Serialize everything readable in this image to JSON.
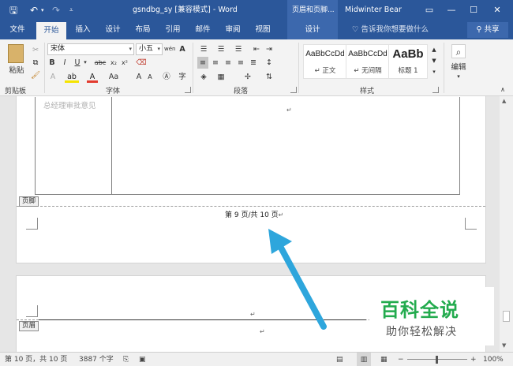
{
  "titlebar": {
    "doc_title": "gsndbg_sy [兼容模式] - Word",
    "context_tab": "页眉和页脚...",
    "user": "Midwinter Bear"
  },
  "tabs": [
    "文件",
    "开始",
    "插入",
    "设计",
    "布局",
    "引用",
    "邮件",
    "审阅",
    "视图",
    "设计"
  ],
  "tell_me": "告诉我你想要做什么",
  "share": "共享",
  "ribbon": {
    "clipboard": {
      "paste": "粘贴",
      "label": "剪贴板"
    },
    "font": {
      "name": "宋体",
      "size": "小五",
      "label": "字体",
      "grow_shrink": "Aa",
      "a_big": "A",
      "a_small": "A"
    },
    "paragraph": {
      "label": "段落"
    },
    "styles": {
      "label": "样式",
      "items": [
        {
          "sample": "AaBbCcDd",
          "name": "↵ 正文"
        },
        {
          "sample": "AaBbCcDd",
          "name": "↵ 无间隔"
        },
        {
          "sample": "AaBb",
          "name": "标题 1"
        }
      ]
    },
    "editing": {
      "label": "编辑"
    }
  },
  "document": {
    "table_cell_text": "总经理审批意见",
    "para_mark": "↵",
    "footer_tag": "页脚",
    "header_tag": "页眉",
    "page_number_text": "第 9 页/共 10 页"
  },
  "statusbar": {
    "page": "第 10 页，共 10 页",
    "words": "3887 个字",
    "zoom": "100%"
  },
  "watermark": {
    "title": "百科全说",
    "subtitle": "助你轻松解决"
  },
  "colors": {
    "accent": "#2b579a",
    "arrow": "#2ea6dc",
    "watermark": "#23ab4e"
  }
}
